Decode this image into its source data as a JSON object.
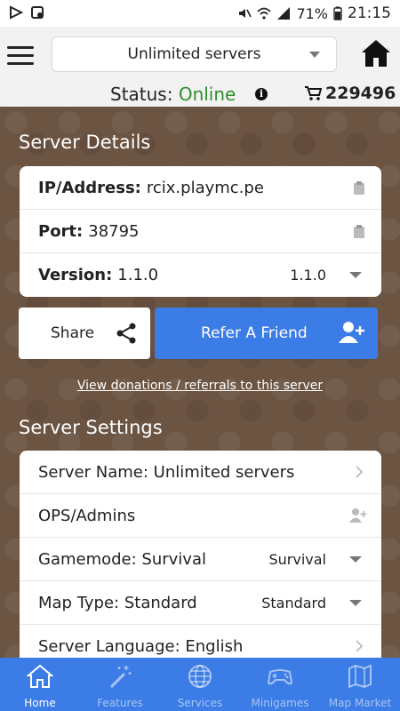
{
  "statusbar": {
    "battery": "71%",
    "time": "21:15"
  },
  "appbar": {
    "server_select": "Unlimited servers",
    "status_label": "Status:",
    "status_value": "Online",
    "info_glyph": "i",
    "coins": "229496"
  },
  "server_details": {
    "title": "Server Details",
    "ip_label": "IP/Address:",
    "ip_value": "rcix.playmc.pe",
    "port_label": "Port:",
    "port_value": "38795",
    "version_label": "Version:",
    "version_value": "1.1.0",
    "version_select": "1.1.0"
  },
  "actions": {
    "share": "Share",
    "refer": "Refer A Friend",
    "donations_link": "View donations / referrals to this server"
  },
  "server_settings": {
    "title": "Server Settings",
    "name_row": "Server Name: Unlimited servers",
    "ops_row": "OPS/Admins",
    "gamemode_row": "Gamemode: Survival",
    "gamemode_select": "Survival",
    "maptype_row": "Map Type: Standard",
    "maptype_select": "Standard",
    "language_row": "Server Language: English"
  },
  "bottomnav": {
    "items": [
      {
        "label": "Home",
        "icon": "home-icon",
        "active": true
      },
      {
        "label": "Features",
        "icon": "magic-wand-icon",
        "active": false
      },
      {
        "label": "Services",
        "icon": "globe-icon",
        "active": false
      },
      {
        "label": "Minigames",
        "icon": "gamepad-icon",
        "active": false
      },
      {
        "label": "Map Market",
        "icon": "map-icon",
        "active": false
      }
    ]
  },
  "colors": {
    "accent": "#3b7ce6",
    "online": "#2f8f2f",
    "background": "#6b5240"
  }
}
